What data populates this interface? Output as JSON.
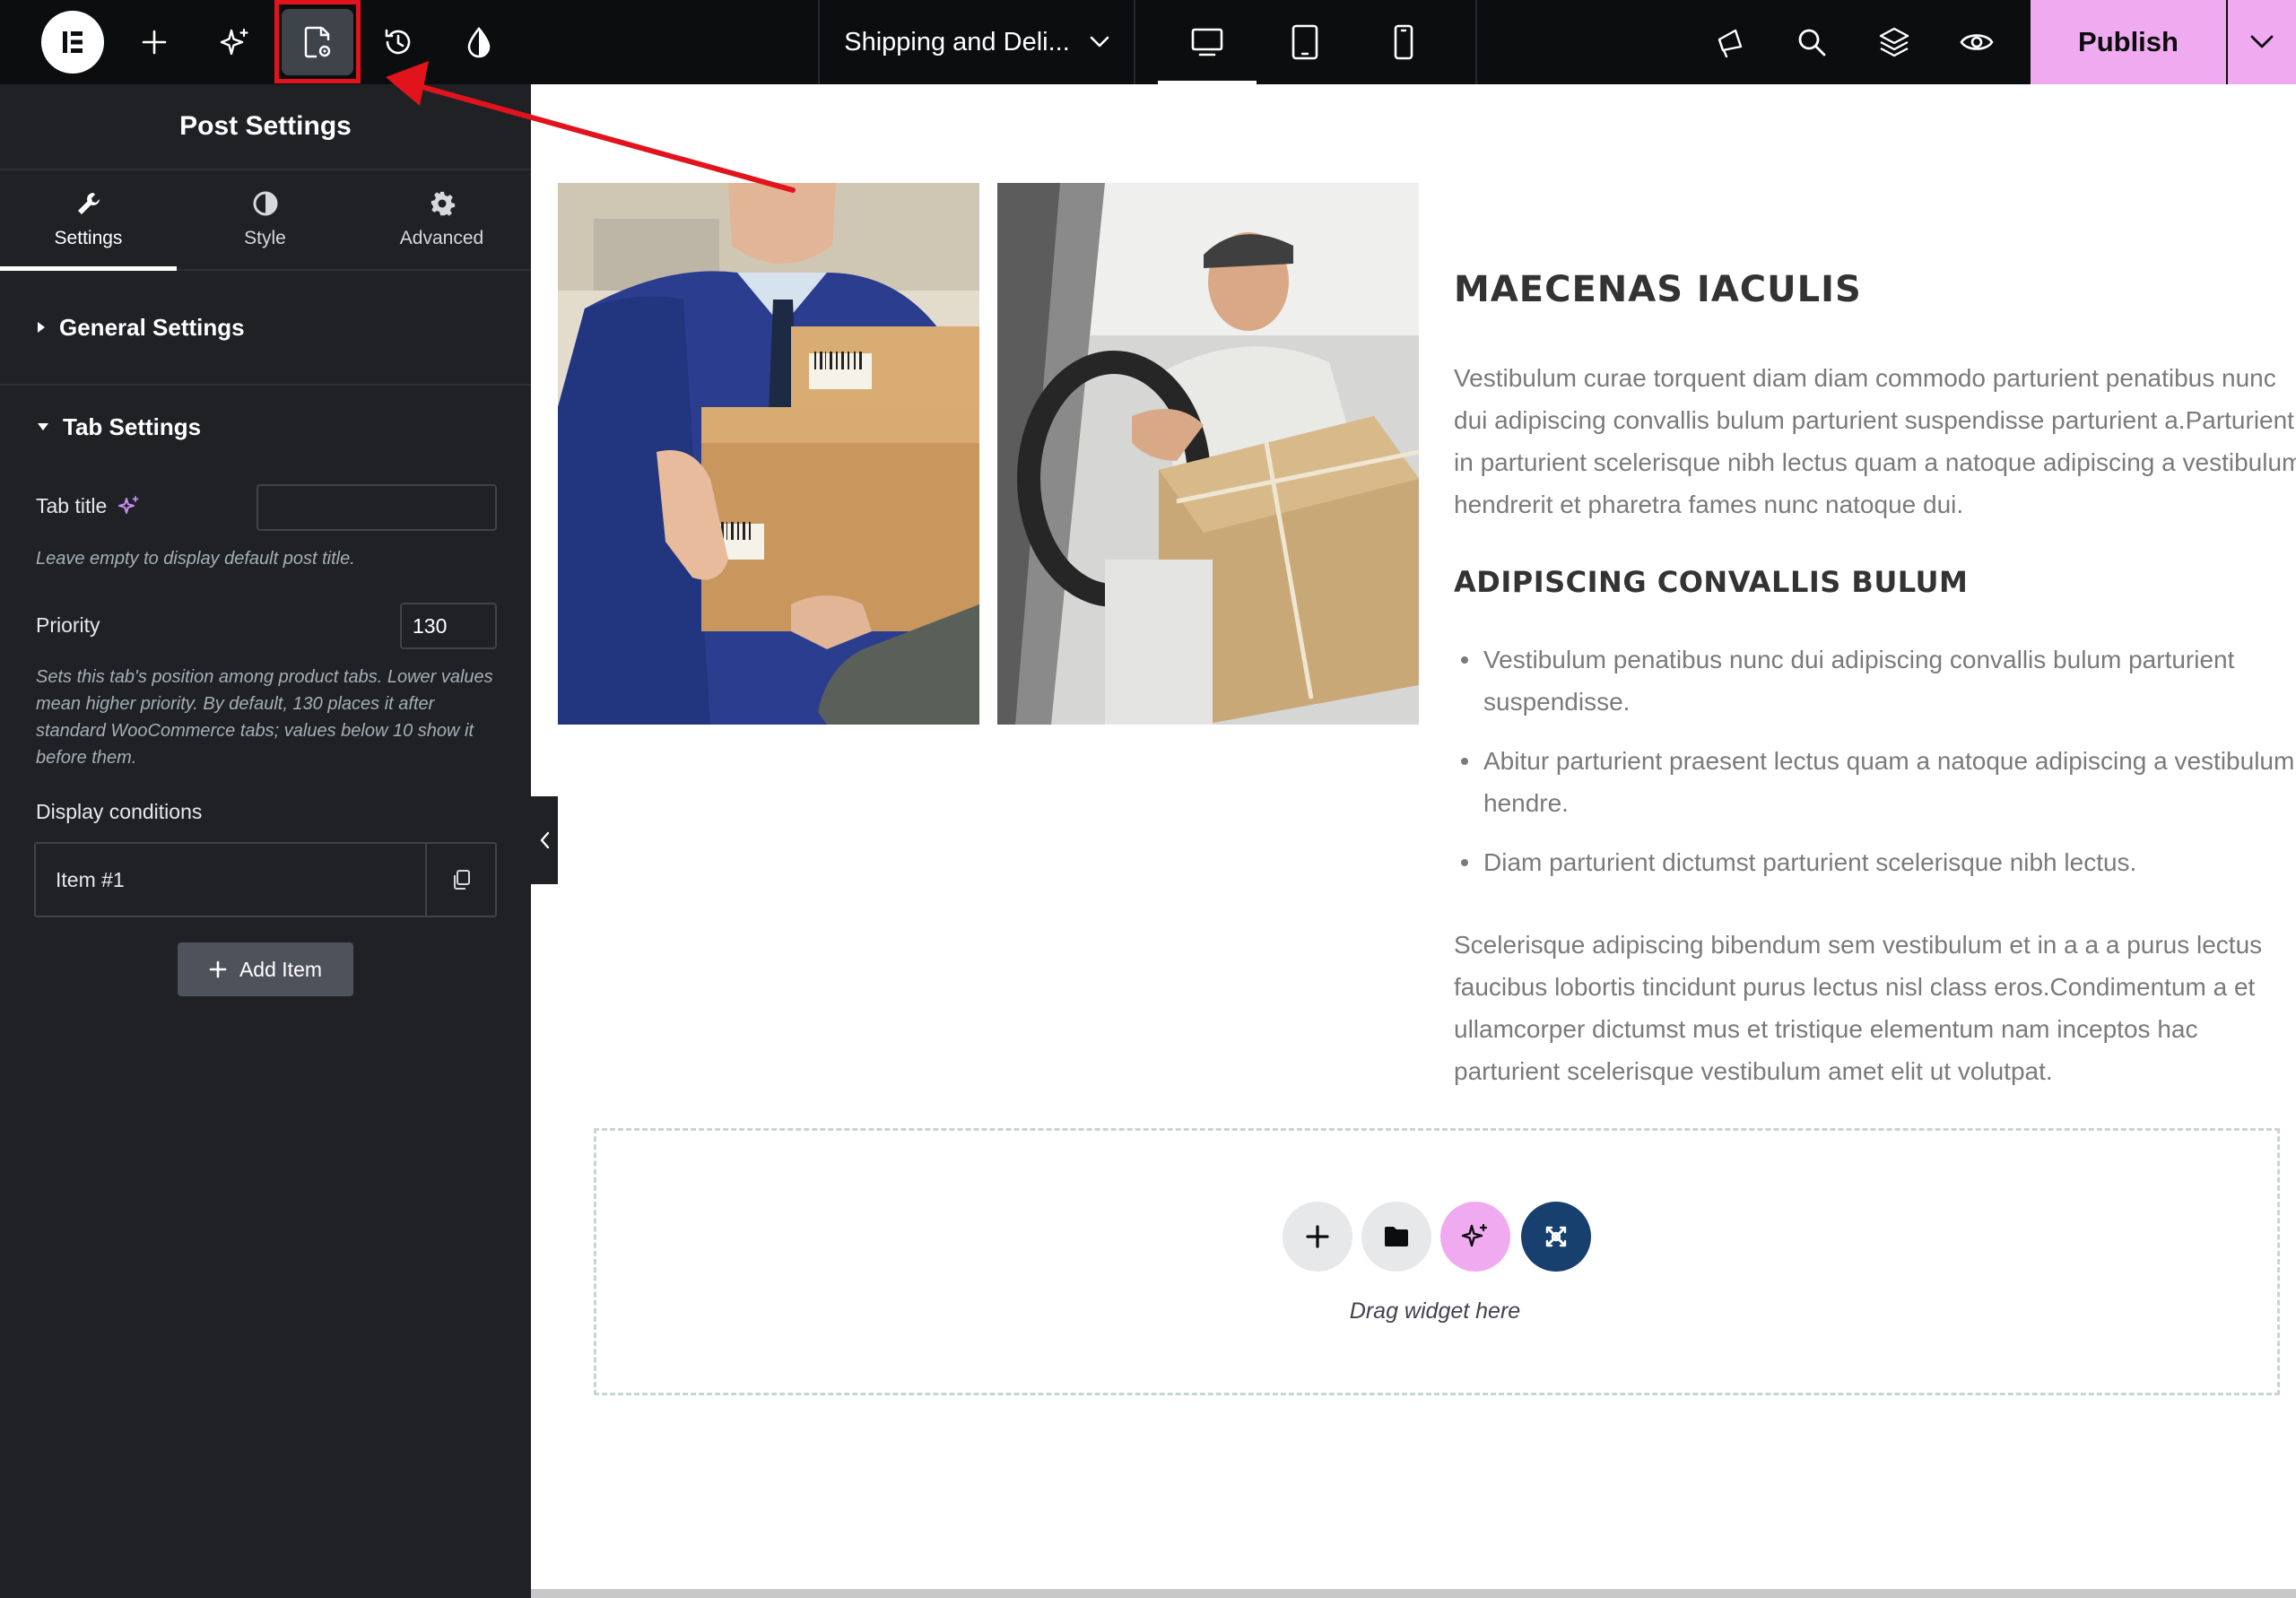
{
  "topbar": {
    "logo_icon": "elementor-logo-icon",
    "add_icon": "plus-icon",
    "ai_icon": "sparkle-icon",
    "page_settings_icon": "page-settings-icon",
    "history_icon": "history-icon",
    "site_settings_icon": "droplet-icon",
    "document_title": "Shipping and Deli...",
    "devices": [
      "desktop",
      "tablet",
      "mobile"
    ],
    "active_device": "desktop",
    "right_icons": [
      "megaphone-icon",
      "search-icon",
      "layers-icon",
      "eye-icon"
    ],
    "publish_label": "Publish",
    "accent_color": "#f0abf0",
    "highlight_color": "#e1141d"
  },
  "panel": {
    "title": "Post Settings",
    "tabs": [
      {
        "label": "Settings",
        "icon": "wrench-icon"
      },
      {
        "label": "Style",
        "icon": "half-circle-icon"
      },
      {
        "label": "Advanced",
        "icon": "gear-icon"
      }
    ],
    "active_tab": "Settings",
    "general_section": "General Settings",
    "tab_section": "Tab Settings",
    "tab_title_label": "Tab title",
    "tab_title_value": "",
    "tab_title_help": "Leave empty to display default post title.",
    "priority_label": "Priority",
    "priority_value": "130",
    "priority_help": "Sets this tab's position among product tabs. Lower values mean higher priority. By default, 130 places it after standard WooCommerce tabs; values below 10 show it before them.",
    "display_conditions_label": "Display conditions",
    "repeater_item": "Item #1",
    "add_item_label": "Add Item"
  },
  "content": {
    "heading1": "MAECENAS IACULIS",
    "paragraph1": "Vestibulum curae torquent diam diam commodo parturient penatibus nunc dui adipiscing convallis bulum parturient suspendisse parturient a.Parturient in parturient scelerisque nibh lectus quam a natoque adipiscing a vestibulum hendrerit et pharetra fames nunc natoque dui.",
    "heading2": "ADIPISCING CONVALLIS BULUM",
    "bullets": [
      "Vestibulum penatibus nunc dui adipiscing convallis bulum parturient suspendisse.",
      "Abitur parturient praesent lectus quam a natoque adipiscing a vestibulum hendre.",
      "Diam parturient dictumst parturient scelerisque nibh lectus."
    ],
    "paragraph2": "Scelerisque adipiscing bibendum sem vestibulum et in a a a purus lectus faucibus lobortis tincidunt purus lectus nisl class eros.Condimentum a et ullamcorper dictumst mus et tristique elementum nam inceptos hac parturient scelerisque vestibulum amet elit ut volutpat.",
    "images": [
      "courier-handing-box-photo",
      "driver-in-van-photo"
    ]
  },
  "dropzone": {
    "buttons": [
      "plus-icon",
      "folder-icon",
      "ai-sparkle-icon",
      "kit-icon"
    ],
    "text": "Drag widget here"
  }
}
